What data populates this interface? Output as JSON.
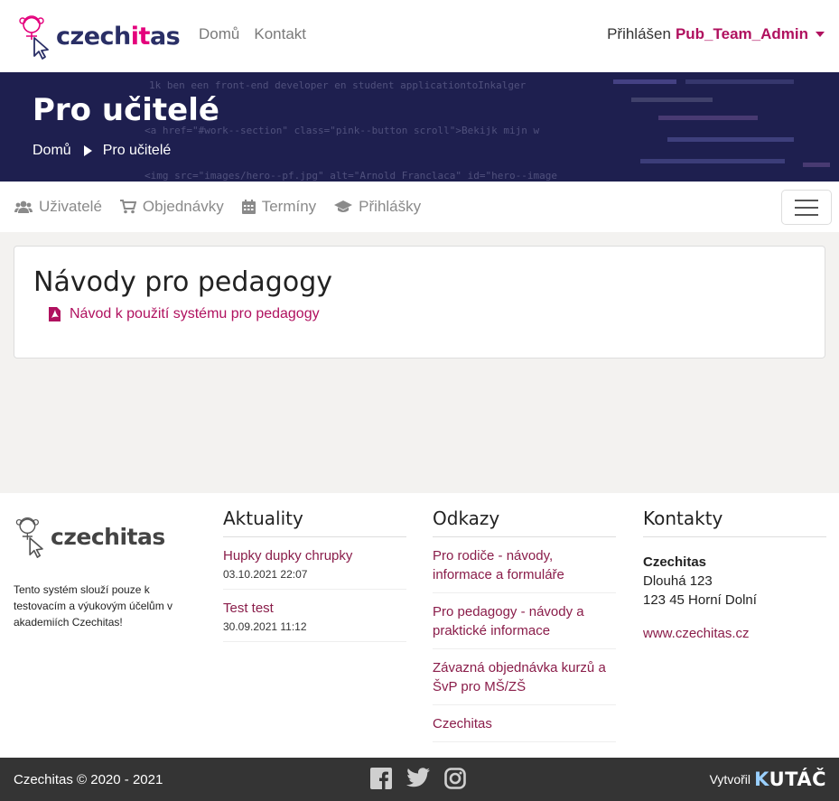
{
  "colors": {
    "brand_navy": "#2a2f66",
    "brand_pink": "#e4007c",
    "link": "#b0115f",
    "hero_bg": "#1e1f4f",
    "footer_bar": "#343434"
  },
  "navbar": {
    "brand_prefix": "czech",
    "brand_highlight": "it",
    "brand_suffix": "as",
    "links": [
      {
        "label": "Domů"
      },
      {
        "label": "Kontakt"
      }
    ],
    "user_prefix": "Přihlášen",
    "user_name": "Pub_Team_Admin"
  },
  "hero": {
    "title": "Pro učitelé",
    "breadcrumb": [
      "Domů",
      "Pro učitelé"
    ],
    "code_lines": [
      "1k ben een front-end developer en student applicationtoInkalger",
      "<a href=\"#work--section\" class=\"pink--button scroll\">Bekijk mijn w",
      "<img src=\"images/hero--pf.jpg\" alt=\"Arnold Franclaca\" id=\"hero--image"
    ]
  },
  "subnav": {
    "items": [
      {
        "label": "Uživatelé",
        "icon": "users-icon"
      },
      {
        "label": "Objednávky",
        "icon": "cart-icon"
      },
      {
        "label": "Termíny",
        "icon": "calendar-icon"
      },
      {
        "label": "Přihlášky",
        "icon": "graduation-cap-icon"
      }
    ]
  },
  "main": {
    "heading": "Návody pro pedagogy",
    "documents": [
      {
        "label": "Návod k použití systému pro pedagogy",
        "icon": "pdf-file-icon"
      }
    ]
  },
  "footer": {
    "logo_prefix": "czech",
    "logo_highlight": "it",
    "logo_suffix": "as",
    "about": "Tento systém slouží pouze k testovacím a výukovým účelům v akademiích Czechitas!",
    "news": {
      "title": "Aktuality",
      "items": [
        {
          "title": "Hupky dupky chrupky",
          "date": "03.10.2021 22:07"
        },
        {
          "title": "Test test",
          "date": "30.09.2021 11:12"
        }
      ]
    },
    "links": {
      "title": "Odkazy",
      "items": [
        {
          "label": "Pro rodiče - návody, informace a formuláře"
        },
        {
          "label": "Pro pedagogy - návody a praktické informace"
        },
        {
          "label": "Závazná objednávka kurzů a ŠvP pro MŠ/ZŠ"
        },
        {
          "label": "Czechitas"
        }
      ]
    },
    "contacts": {
      "title": "Kontakty",
      "name": "Czechitas",
      "street": "Dlouhá 123",
      "city": "123 45 Horní Dolní",
      "web": "www.czechitas.cz"
    }
  },
  "bottombar": {
    "copyright": "Czechitas © 2020 - 2021",
    "social": [
      "facebook-icon",
      "twitter-icon",
      "instagram-icon"
    ],
    "made_by_label": "Vytvořil",
    "made_by_first": "K",
    "made_by_rest": "UTÁČ"
  }
}
